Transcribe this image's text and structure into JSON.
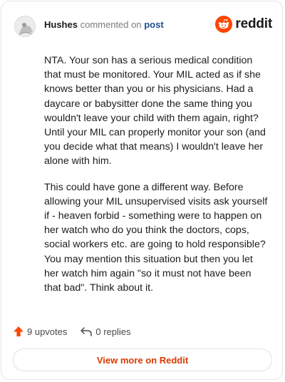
{
  "comment": {
    "username": "Hushes",
    "action_text": "commented on",
    "post_link": "post",
    "brand_wordmark": "reddit",
    "paragraphs": [
      "NTA. Your son has a serious medical condition that must be monitored. Your MIL acted as if she knows better than you or his physicians. Had a daycare or babysitter done the same thing you wouldn't leave your child with them again, right? Until your MIL can properly monitor your son (and you decide what that means) I wouldn't leave her alone with him.",
      "This could have gone a different way. Before allowing your MIL unsupervised visits ask yourself if - heaven forbid - something were to happen on her watch who do you think the doctors, cops, social workers etc. are going to hold responsible? You may mention this situation but then you let her watch him again \"so it must not have been that bad\". Think about it."
    ],
    "upvotes_label": "9 upvotes",
    "replies_label": "0 replies",
    "view_more_label": "View more on Reddit"
  },
  "colors": {
    "brand_orange": "#ff4500",
    "link_blue": "#1f4e8c",
    "button_text": "#d93a00"
  },
  "icons": {
    "avatar": "user-avatar",
    "logo": "reddit-snoo-icon",
    "upvote": "upvote-arrow-icon",
    "reply": "reply-arrow-icon"
  }
}
